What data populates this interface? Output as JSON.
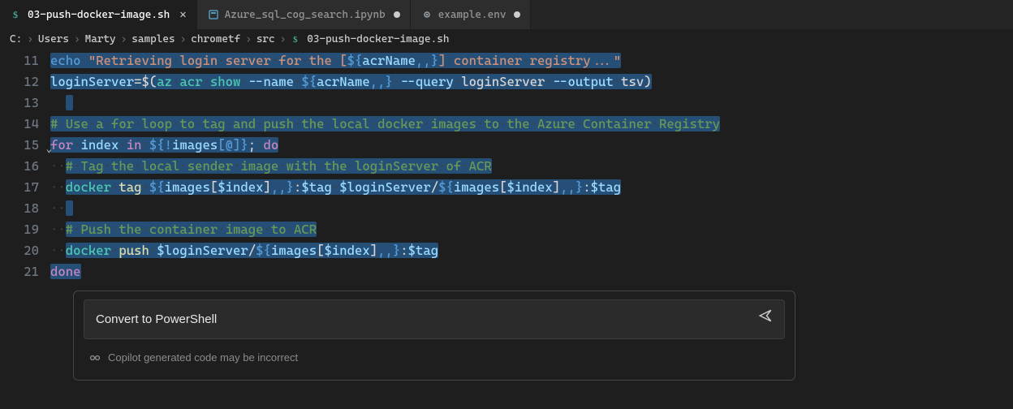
{
  "tabs": [
    {
      "label": "03-push-docker-image.sh",
      "icon": "dollar",
      "active": true,
      "dirty": false
    },
    {
      "label": "Azure_sql_cog_search.ipynb",
      "icon": "notebook",
      "active": false,
      "dirty": true
    },
    {
      "label": "example.env",
      "icon": "gear",
      "active": false,
      "dirty": true
    }
  ],
  "breadcrumbs": {
    "parts": [
      "C:",
      "Users",
      "Marty",
      "samples",
      "chrometf",
      "src"
    ],
    "file_icon": "dollar",
    "file": "03-push-docker-image.sh"
  },
  "gutter": {
    "start": 11,
    "end": 21,
    "fold_line": 15
  },
  "code": {
    "l11": {
      "echo": "echo",
      "str_open": "\"Retrieving",
      "ws1": "·",
      "str_a": "login",
      "ws2": "·",
      "str_b": "server",
      "ws3": "·",
      "str_c": "for",
      "ws4": "·",
      "str_d": "the",
      "ws5": "·",
      "str_e": "[",
      "interp": "${",
      "interp_var": "acrName",
      "interp_tail": ",,}",
      "str_f": "]",
      "ws6": "·",
      "str_g": "container",
      "ws7": "·",
      "str_h": "registry...\""
    },
    "l12": {
      "var": "loginServer",
      "eq": "=$(",
      "cmd1": "az",
      "ws1": "·",
      "cmd2": "acr",
      "ws2": "·",
      "cmd3": "show",
      "ws3": "·",
      "opt1": "--name",
      "ws4": "·",
      "interp": "${",
      "interp_var": "acrName",
      "interp_tail": ",,}",
      "ws5": "·",
      "opt2": "--query",
      "ws6": "·",
      "arg1": "loginServer",
      "ws7": "·",
      "opt3": "--output",
      "ws8": "·",
      "arg2": "tsv",
      "close": ")"
    },
    "l13": {
      "blank": " "
    },
    "l14": {
      "hash": "#",
      "ws1": "·",
      "w1": "Use",
      "ws2": "·",
      "w2": "a",
      "ws3": "·",
      "w3": "for",
      "ws4": "·",
      "w4": "loop",
      "ws5": "·",
      "w5": "to",
      "ws6": "·",
      "w6": "tag",
      "ws7": "·",
      "w7": "and",
      "ws8": "·",
      "w8": "push",
      "ws9": "·",
      "w9": "the",
      "ws10": "·",
      "w10": "local",
      "ws11": "·",
      "w11": "docker",
      "ws12": "·",
      "w12": "images",
      "ws13": "·",
      "w13": "to",
      "ws14": "·",
      "w14": "the",
      "ws15": "·",
      "w15": "Azure",
      "ws16": "·",
      "w16": "Container",
      "ws17": "·",
      "w17": "Registry"
    },
    "l15": {
      "kw_for": "for",
      "ws1": "·",
      "var": "index",
      "ws2": "·",
      "kw_in": "in",
      "ws3": "·",
      "interp": "${!",
      "interp_var": "images",
      "interp_br": "[@]}",
      "semi": ";",
      "ws4": "·",
      "kw_do": "do"
    },
    "l16": {
      "lead": "··",
      "hash": "#",
      "ws1": "·",
      "w1": "Tag",
      "ws2": "·",
      "w2": "the",
      "ws3": "·",
      "w3": "local",
      "ws4": "·",
      "w4": "sender",
      "ws5": "·",
      "w5": "image",
      "ws6": "·",
      "w6": "with",
      "ws7": "·",
      "w7": "the",
      "ws8": "·",
      "w8": "loginServer",
      "ws9": "·",
      "w9": "of",
      "ws10": "·",
      "w10": "ACR"
    },
    "l17": {
      "lead": "··",
      "cmd": "docker",
      "ws1": "·",
      "sub": "tag",
      "ws2": "·",
      "a_interp": "${",
      "a_var": "images",
      "a_br_o": "[",
      "a_idx": "$index",
      "a_br_c": "]",
      "a_tail": ",,}",
      "colon1": ":",
      "tag1": "$tag",
      "ws3": "·",
      "login": "$loginServer",
      "slash": "/",
      "b_interp": "${",
      "b_var": "images",
      "b_br_o": "[",
      "b_idx": "$index",
      "b_br_c": "]",
      "b_tail": ",,}",
      "colon2": ":",
      "tag2": "$tag"
    },
    "l18": {
      "lead": "··",
      "blank": " "
    },
    "l19": {
      "lead": "··",
      "hash": "#",
      "ws1": "·",
      "w1": "Push",
      "ws2": "·",
      "w2": "the",
      "ws3": "·",
      "w3": "container",
      "ws4": "·",
      "w4": "image",
      "ws5": "·",
      "w5": "to",
      "ws6": "·",
      "w6": "ACR"
    },
    "l20": {
      "lead": "··",
      "cmd": "docker",
      "ws1": "·",
      "sub": "push",
      "ws2": "·",
      "login": "$loginServer",
      "slash": "/",
      "interp": "${",
      "ivar": "images",
      "br_o": "[",
      "idx": "$index",
      "br_c": "]",
      "tail": ",,}",
      "colon": ":",
      "tag": "$tag"
    },
    "l21": {
      "done": "done"
    }
  },
  "copilot": {
    "input_value": "Convert to PowerShell",
    "footer_text": "Copilot generated code may be incorrect"
  }
}
